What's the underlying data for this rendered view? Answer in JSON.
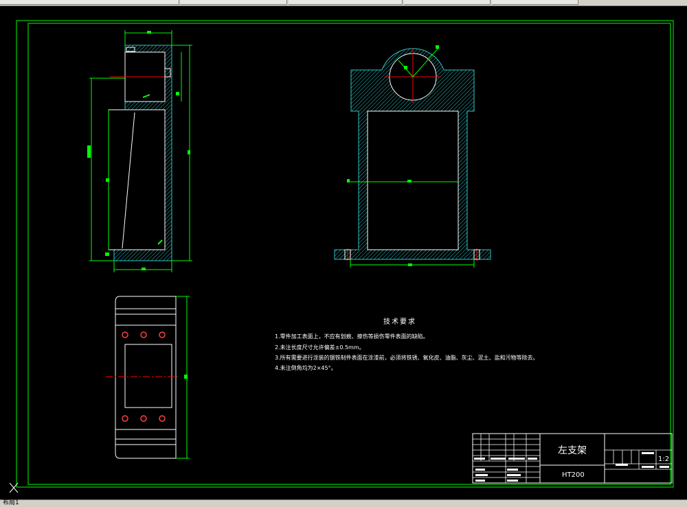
{
  "app": {
    "layout_tab": "布局1"
  },
  "drawing": {
    "part_name": "左支架",
    "material": "HT200",
    "scale": "1:2",
    "tech_title": "技术要求",
    "tech_notes": [
      "1.零件加工表面上，不应有划痕、擦伤等损伤零件表面的缺陷。",
      "2.未注长度尺寸允许偏差±0.5mm。",
      "3.所有需要进行涂装的钢铁制件表面在涂漆前，必须将铁锈、氧化皮、油脂、灰尘、泥土、盐和污物等除去。",
      "4.未注倒角均为2×45°。"
    ]
  },
  "colors": {
    "background": "#000000",
    "border": "#00ff00",
    "outline": "#ffffff",
    "hatch": "#2ec4c4",
    "dimension": "#00ff00",
    "centerline": "#ff0000"
  }
}
